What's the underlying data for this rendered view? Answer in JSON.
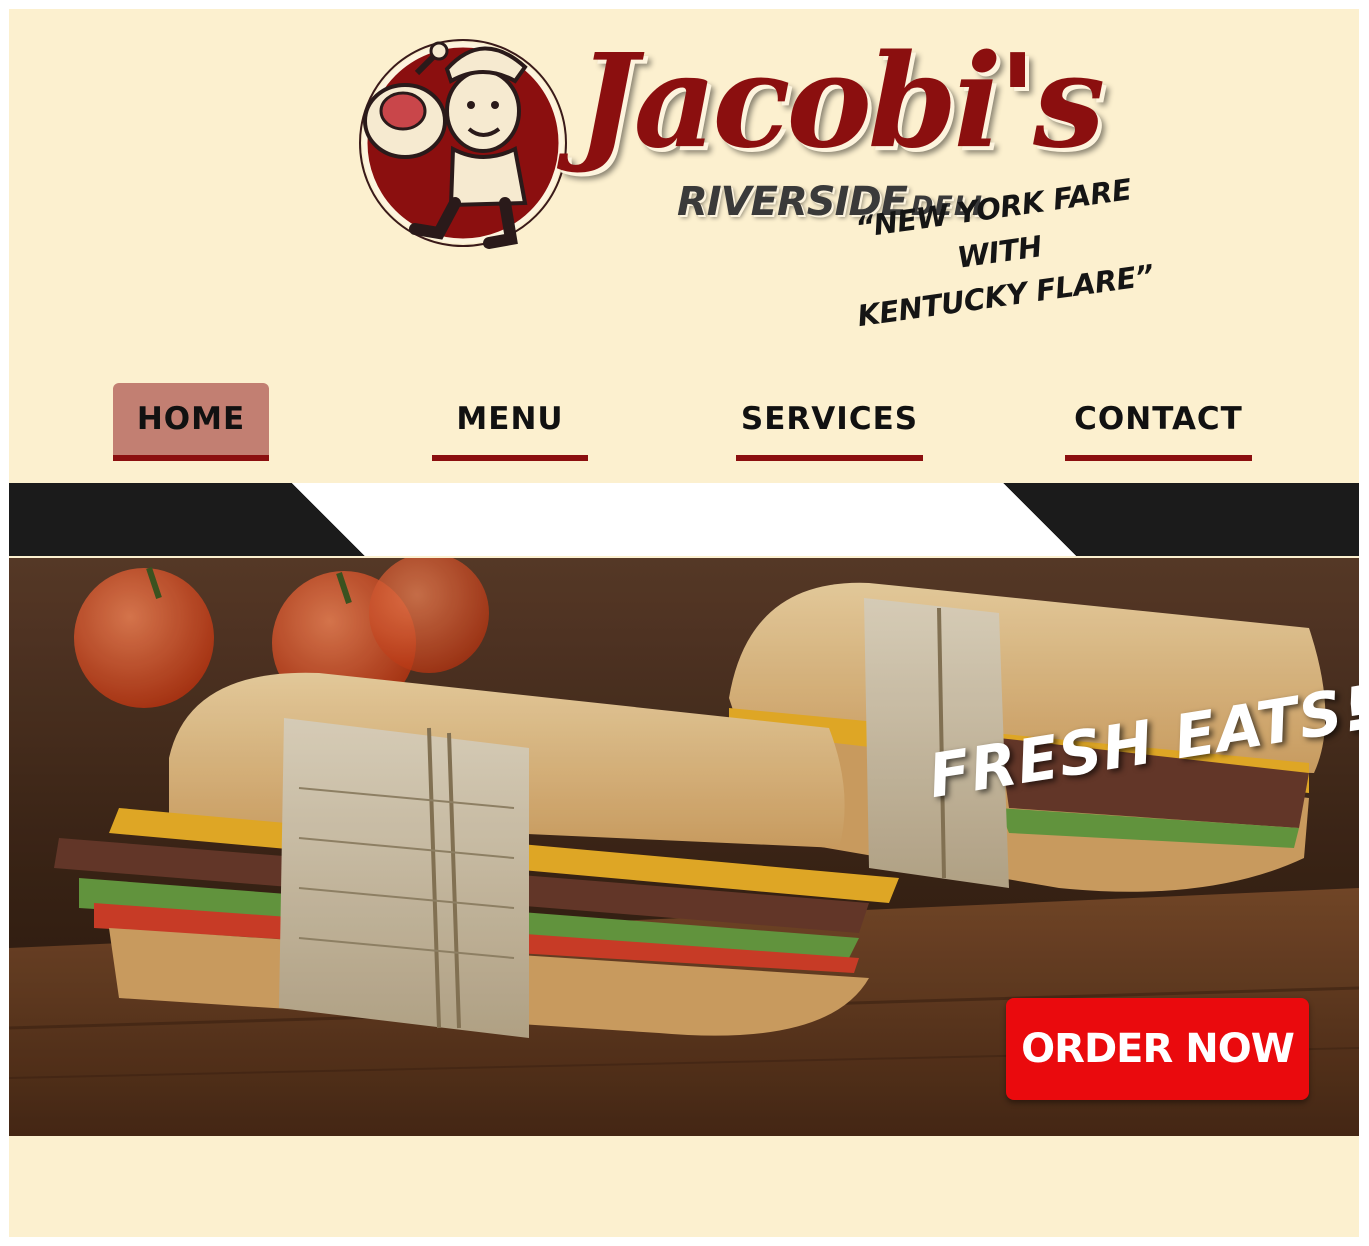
{
  "brand": {
    "name": "Jacobi's",
    "sub_main": "RIVERSIDE",
    "sub_small": "DELI",
    "tagline_line1": "“NEW YORK FARE WITH",
    "tagline_line2": "KENTUCKY FLARE”",
    "primary_color": "#8b0f0f",
    "background_color": "#fcf0cf"
  },
  "nav": {
    "items": [
      {
        "label": "HOME",
        "active": true
      },
      {
        "label": "MENU",
        "active": false
      },
      {
        "label": "SERVICES",
        "active": false
      },
      {
        "label": "CONTACT",
        "active": false
      }
    ],
    "active_color": "#c27f72"
  },
  "hero": {
    "headline": "FRESH EATS!",
    "cta_label": "ORDER NOW",
    "cta_color": "#ea0a0d"
  }
}
